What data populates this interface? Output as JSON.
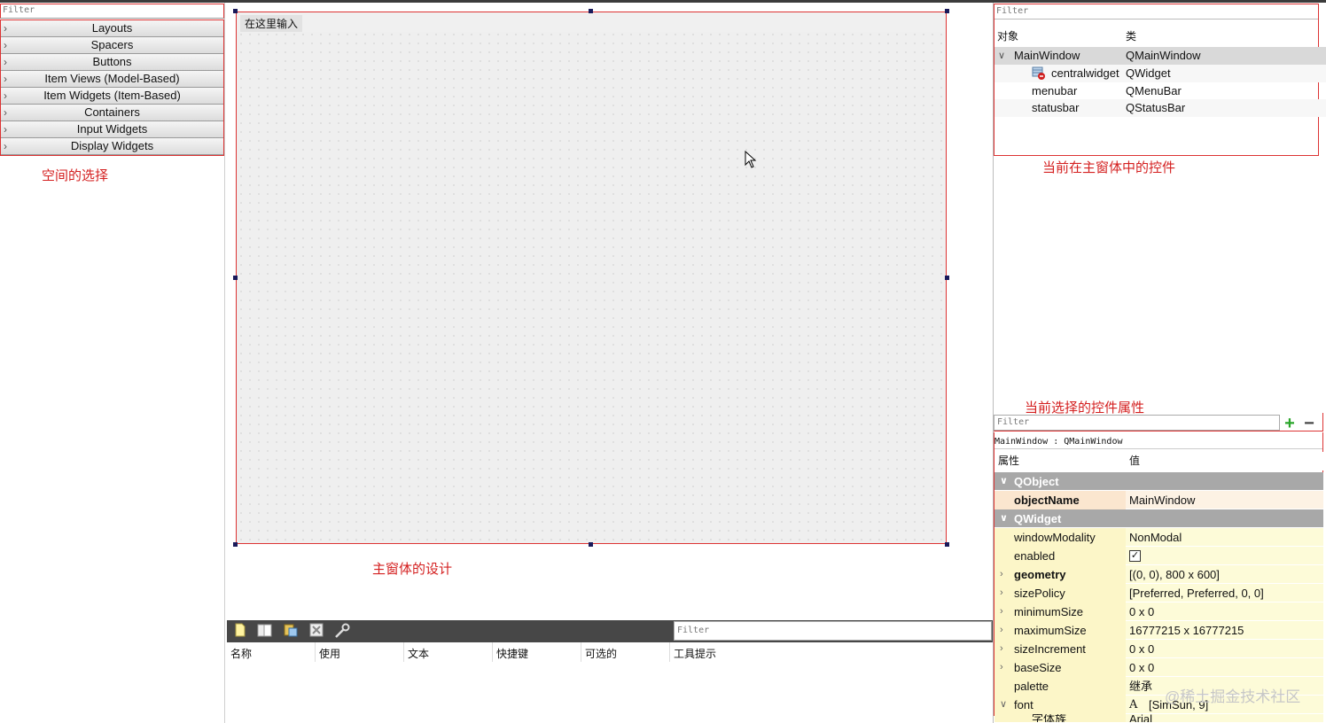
{
  "widget_box": {
    "filter_placeholder": "Filter",
    "categories": [
      "Layouts",
      "Spacers",
      "Buttons",
      "Item Views (Model-Based)",
      "Item Widgets (Item-Based)",
      "Containers",
      "Input Widgets",
      "Display Widgets"
    ],
    "annotation": "空间的选择"
  },
  "form": {
    "menu_placeholder": "在这里输入",
    "annotation": "主窗体的设计"
  },
  "action_editor": {
    "filter_placeholder": "Filter",
    "columns": [
      "名称",
      "使用",
      "文本",
      "快捷键",
      "可选的",
      "工具提示"
    ]
  },
  "object_inspector": {
    "filter_placeholder": "Filter",
    "headers": {
      "object": "对象",
      "class": "类"
    },
    "rows": [
      {
        "name": "MainWindow",
        "class": "QMainWindow"
      },
      {
        "name": "centralwidget",
        "class": "QWidget"
      },
      {
        "name": "menubar",
        "class": "QMenuBar"
      },
      {
        "name": "statusbar",
        "class": "QStatusBar"
      }
    ],
    "annotation": "当前在主窗体中的控件"
  },
  "property_editor": {
    "annotation": "当前选择的控件属性",
    "filter_placeholder": "Filter",
    "class_line": "MainWindow : QMainWindow",
    "headers": {
      "property": "属性",
      "value": "值"
    },
    "groups": {
      "qobject": "QObject",
      "qwidget": "QWidget"
    },
    "rows": [
      {
        "key": "objectName",
        "value": "MainWindow"
      },
      {
        "key": "windowModality",
        "value": "NonModal"
      },
      {
        "key": "enabled",
        "value": ""
      },
      {
        "key": "geometry",
        "value": "[(0, 0), 800 x 600]"
      },
      {
        "key": "sizePolicy",
        "value": "[Preferred, Preferred, 0, 0]"
      },
      {
        "key": "minimumSize",
        "value": "0 x 0"
      },
      {
        "key": "maximumSize",
        "value": "16777215 x 16777215"
      },
      {
        "key": "sizeIncrement",
        "value": "0 x 0"
      },
      {
        "key": "baseSize",
        "value": "0 x 0"
      },
      {
        "key": "palette",
        "value": "继承"
      },
      {
        "key": "font",
        "value": "[SimSun, 9]"
      }
    ],
    "partial_row": {
      "key": "字体族",
      "value": "Arial"
    }
  },
  "watermark": "@稀土掘金技术社区",
  "colors": {
    "annotation": "#d42020",
    "group_header": "#a8a8a8",
    "highlight_row": "#fdfbd8"
  }
}
